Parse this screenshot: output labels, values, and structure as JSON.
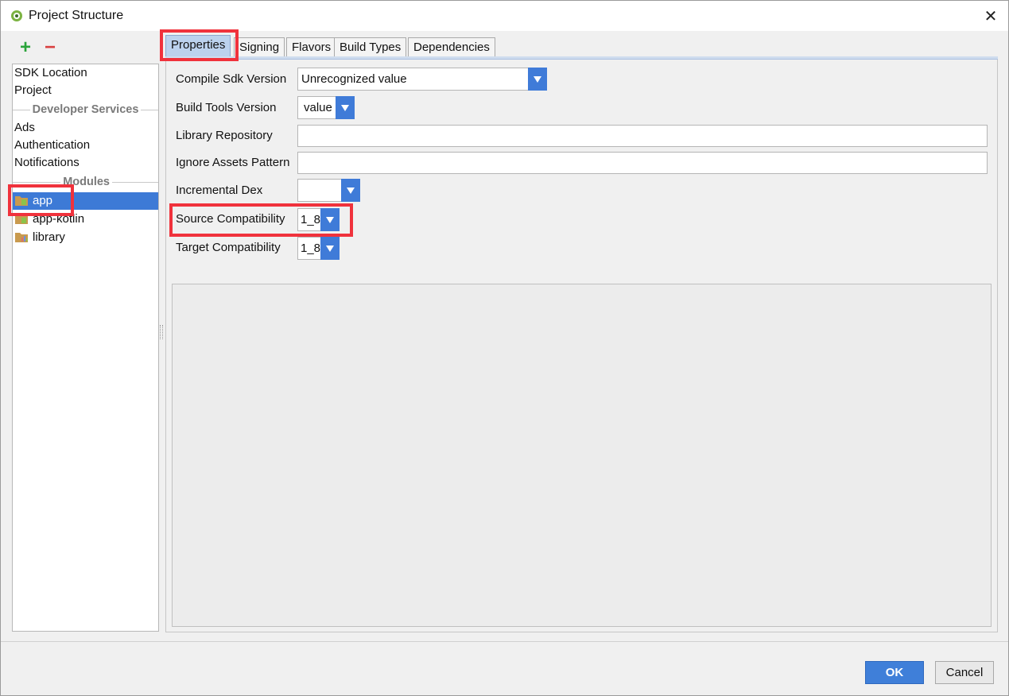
{
  "window": {
    "title": "Project Structure",
    "close_glyph": "✕"
  },
  "toolbar": {
    "add_glyph": "+",
    "remove_glyph": "−"
  },
  "sidebar": {
    "items_top": [
      "SDK Location",
      "Project"
    ],
    "section_developer": "Developer Services",
    "items_dev": [
      "Ads",
      "Authentication",
      "Notifications"
    ],
    "section_modules": "Modules",
    "modules": [
      "app",
      "app-kotlin",
      "library"
    ],
    "selected_module": "app"
  },
  "tabs": [
    "Properties",
    "Signing",
    "Flavors",
    "Build Types",
    "Dependencies"
  ],
  "active_tab": "Properties",
  "form": {
    "compile_sdk_label": "Compile Sdk Version",
    "compile_sdk_value": "Unrecognized value",
    "build_tools_label": "Build Tools Version",
    "build_tools_value": "value",
    "library_repo_label": "Library Repository",
    "library_repo_value": "",
    "ignore_assets_label": "Ignore Assets Pattern",
    "ignore_assets_value": "",
    "incremental_dex_label": "Incremental Dex",
    "incremental_dex_value": "",
    "source_compat_label": "Source Compatibility",
    "source_compat_value": "1_8",
    "target_compat_label": "Target Compatibility",
    "target_compat_value": "1_8"
  },
  "buttons": {
    "ok": "OK",
    "cancel": "Cancel"
  },
  "colors": {
    "accent": "#3f7bd8",
    "selection": "#3d7ad6",
    "highlight": "#f0323c"
  }
}
